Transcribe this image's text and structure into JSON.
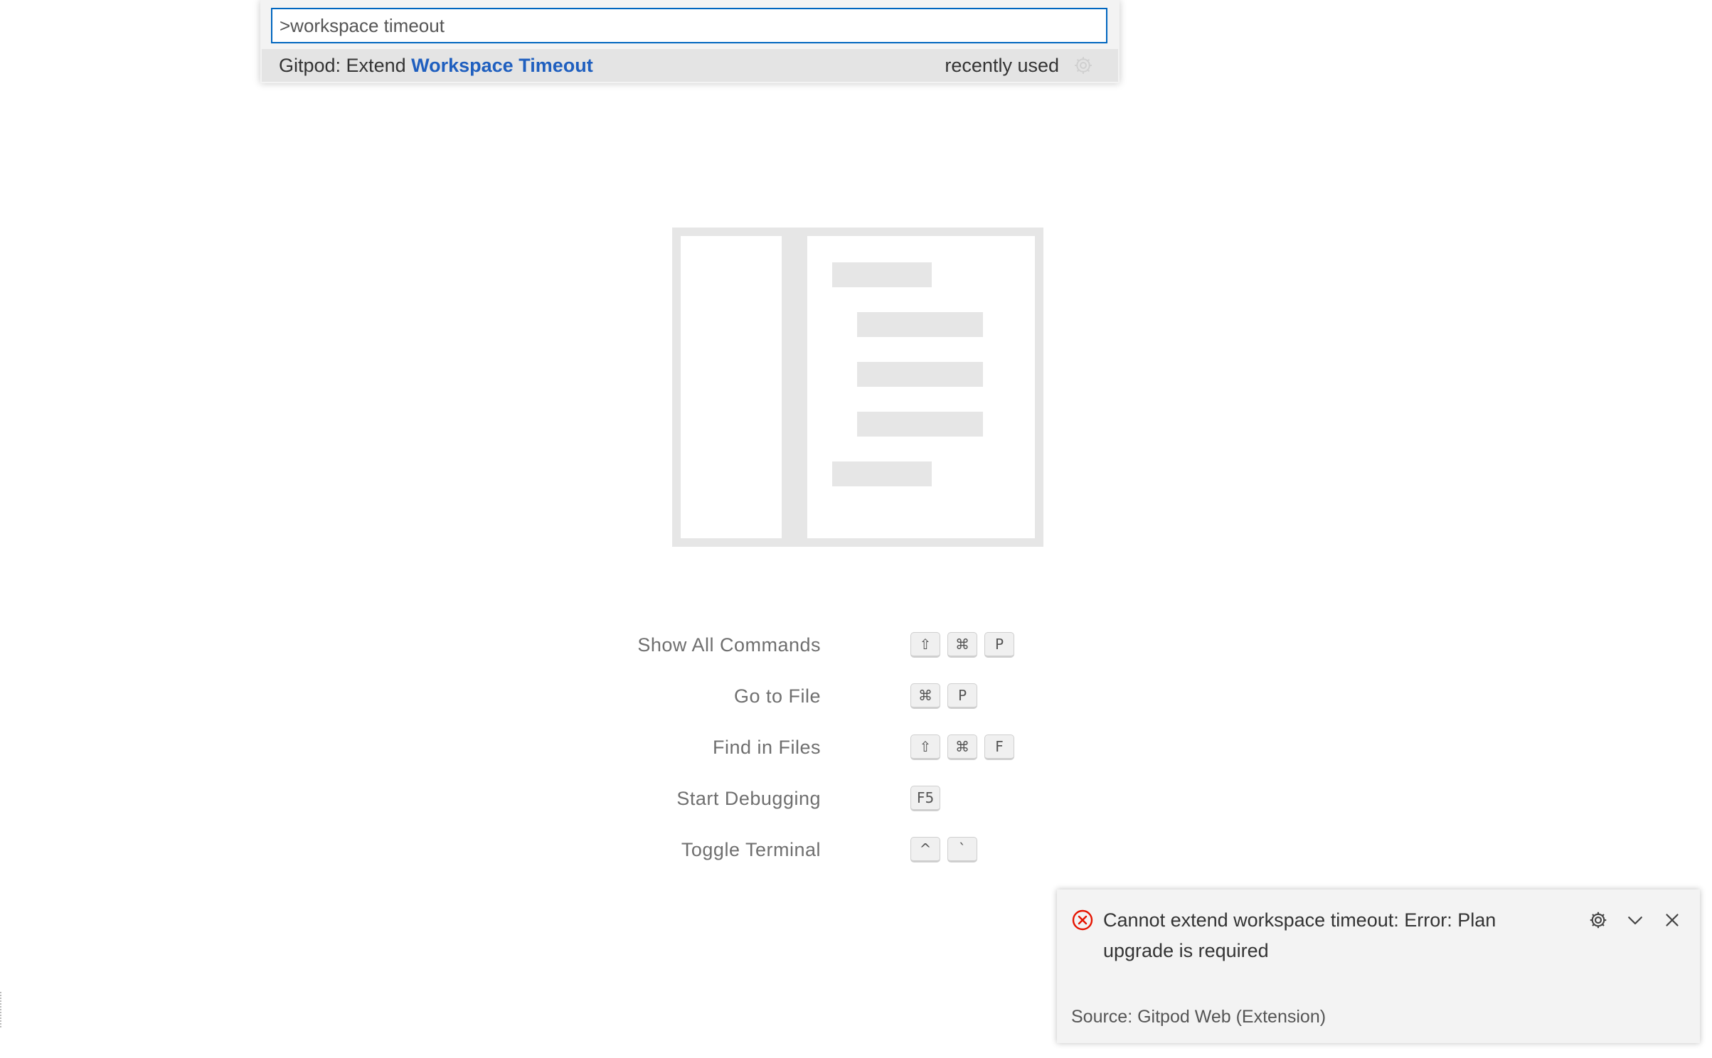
{
  "quick_pick": {
    "input_value": ">workspace timeout",
    "items": [
      {
        "prefix": "Gitpod: Extend ",
        "highlight": "Workspace Timeout",
        "description": "recently used",
        "action_icon": "gear-icon"
      }
    ]
  },
  "watermark": {
    "icon": "editor-layout-watermark-icon"
  },
  "shortcuts": [
    {
      "label": "Show All Commands",
      "keys": [
        "⇧",
        "⌘",
        "P"
      ]
    },
    {
      "label": "Go to File",
      "keys": [
        "⌘",
        "P"
      ]
    },
    {
      "label": "Find in Files",
      "keys": [
        "⇧",
        "⌘",
        "F"
      ]
    },
    {
      "label": "Start Debugging",
      "keys": [
        "F5"
      ]
    },
    {
      "label": "Toggle Terminal",
      "keys": [
        "^",
        "`"
      ]
    }
  ],
  "notification": {
    "severity": "error",
    "message": "Cannot extend workspace timeout: Error: Plan upgrade is required",
    "source": "Source: Gitpod Web (Extension)",
    "icons": [
      "error-icon",
      "gear-icon",
      "chevron-down-icon",
      "close-icon"
    ]
  },
  "colors": {
    "accent": "#0066bf",
    "highlight": "#1f5fbf",
    "error": "#e51400",
    "watermark": "#e6e6e6"
  }
}
